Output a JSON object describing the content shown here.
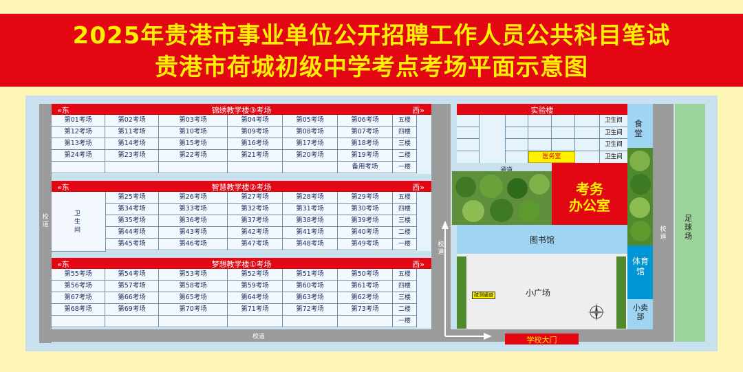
{
  "title": {
    "line1": "2025年贵港市事业单位公开招聘工作人员公共科目笔试",
    "line2": "贵港市荷城初级中学考点考场平面示意图"
  },
  "directions": {
    "east": "«东",
    "west": "西»"
  },
  "buildings": [
    {
      "name": "锦绣教学楼③考场",
      "rows": [
        [
          "第01考场",
          "第02考场",
          "第03考场",
          "第04考场",
          "第05考场",
          "第06考场",
          "五楼"
        ],
        [
          "第12考场",
          "第11考场",
          "第10考场",
          "第09考场",
          "第08考场",
          "第07考场",
          "四楼"
        ],
        [
          "第13考场",
          "第14考场",
          "第15考场",
          "第16考场",
          "第17考场",
          "第18考场",
          "三楼"
        ],
        [
          "第24考场",
          "第23考场",
          "第22考场",
          "第21考场",
          "第20考场",
          "第19考场",
          "二楼"
        ],
        [
          "",
          "",
          "",
          "",
          "",
          "备用考场",
          "一楼"
        ]
      ]
    },
    {
      "name": "智慧教学楼②考场",
      "rows": [
        [
          "",
          "第25考场",
          "第26考场",
          "第27考场",
          "第28考场",
          "第29考场",
          "五楼"
        ],
        [
          "",
          "第34考场",
          "第33考场",
          "第32考场",
          "第31考场",
          "第30考场",
          "四楼"
        ],
        [
          "",
          "第35考场",
          "第36考场",
          "第37考场",
          "第38考场",
          "第39考场",
          "三楼"
        ],
        [
          "",
          "第44考场",
          "第43考场",
          "第42考场",
          "第41考场",
          "第40考场",
          "二楼"
        ],
        [
          "",
          "第45考场",
          "第46考场",
          "第47考场",
          "第48考场",
          "第49考场",
          "一楼"
        ]
      ]
    },
    {
      "name": "梦想教学楼①考场",
      "rows": [
        [
          "第55考场",
          "第54考场",
          "第53考场",
          "第52考场",
          "第51考场",
          "第50考场",
          "五楼"
        ],
        [
          "第56考场",
          "第57考场",
          "第58考场",
          "第59考场",
          "第60考场",
          "第61考场",
          "四楼"
        ],
        [
          "第67考场",
          "第66考场",
          "第65考场",
          "第64考场",
          "第63考场",
          "第62考场",
          "三楼"
        ],
        [
          "第68考场",
          "第69考场",
          "第70考场",
          "第71考场",
          "第72考场",
          "第73考场",
          "二楼"
        ],
        [
          "",
          "",
          "",
          "",
          "",
          "",
          "一楼"
        ]
      ]
    }
  ],
  "toilet": "卫生间",
  "lab": {
    "name": "实验楼",
    "toilets": [
      "卫生间",
      "卫生间",
      "卫生间",
      "卫生间"
    ],
    "clinic": "医务室"
  },
  "canteen": "食堂",
  "office": {
    "line1": "考务",
    "line2": "办公室"
  },
  "passage": "通道",
  "library": "图书馆",
  "gym": "体育馆",
  "shop": "小卖部",
  "plaza": "小广场",
  "plaza_sign": "疏测通道",
  "football": "足球场",
  "campus_road": "校道",
  "gate": "学校大门"
}
